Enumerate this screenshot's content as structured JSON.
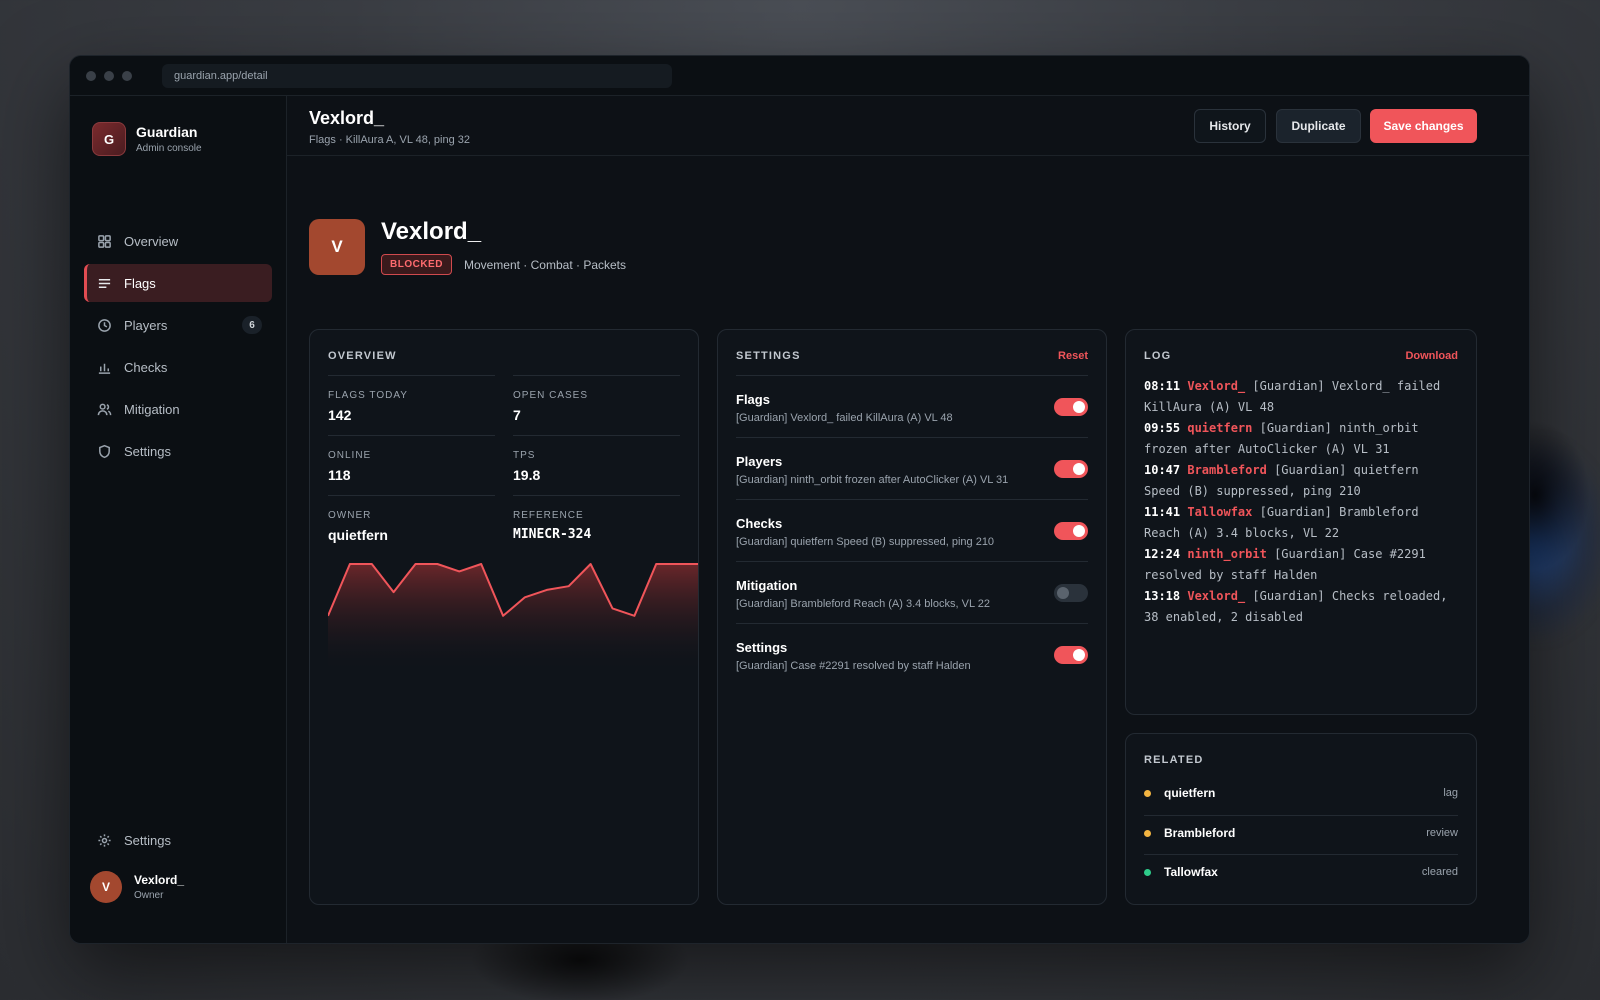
{
  "window": {
    "url": "guardian.app/detail"
  },
  "brand": {
    "logo_letter": "G",
    "name": "Guardian",
    "subtitle": "Admin console"
  },
  "nav": {
    "items": [
      {
        "label": "Overview",
        "icon": "grid-icon"
      },
      {
        "label": "Flags",
        "icon": "list-icon",
        "active": true
      },
      {
        "label": "Players",
        "icon": "clock-icon",
        "badge": "6"
      },
      {
        "label": "Checks",
        "icon": "bar-chart-icon"
      },
      {
        "label": "Mitigation",
        "icon": "users-icon"
      },
      {
        "label": "Settings",
        "icon": "shield-icon"
      }
    ],
    "bottom_settings": "Settings"
  },
  "user": {
    "initial": "V",
    "name": "Vexlord_",
    "role": "Owner"
  },
  "header": {
    "title": "Vexlord_",
    "subtitle": "Flags · KillAura A, VL 48, ping 32",
    "history_label": "History",
    "duplicate_label": "Duplicate",
    "save_label": "Save changes"
  },
  "hero": {
    "initial": "V",
    "name": "Vexlord_",
    "status": "BLOCKED",
    "tags": "Movement · Combat · Packets"
  },
  "overview": {
    "title": "OVERVIEW",
    "stats": [
      {
        "label": "FLAGS TODAY",
        "value": "142"
      },
      {
        "label": "OPEN CASES",
        "value": "7"
      },
      {
        "label": "ONLINE",
        "value": "118"
      },
      {
        "label": "TPS",
        "value": "19.8"
      },
      {
        "label": "OWNER",
        "value": "quietfern"
      },
      {
        "label": "REFERENCE",
        "value": "MINECR-324"
      }
    ],
    "sparkline": [
      30,
      100,
      100,
      62,
      100,
      100,
      90,
      100,
      30,
      55,
      65,
      70,
      100,
      40,
      30,
      100,
      100,
      100
    ]
  },
  "settings": {
    "title": "SETTINGS",
    "reset_label": "Reset",
    "items": [
      {
        "name": "Flags",
        "desc": "[Guardian] Vexlord_ failed KillAura (A) VL 48",
        "on": true
      },
      {
        "name": "Players",
        "desc": "[Guardian] ninth_orbit frozen after AutoClicker (A) VL 31",
        "on": true
      },
      {
        "name": "Checks",
        "desc": "[Guardian] quietfern Speed (B) suppressed, ping 210",
        "on": true
      },
      {
        "name": "Mitigation",
        "desc": "[Guardian] Brambleford Reach (A) 3.4 blocks, VL 22",
        "on": false
      },
      {
        "name": "Settings",
        "desc": "[Guardian] Case #2291 resolved by staff Halden",
        "on": true
      }
    ]
  },
  "log": {
    "title": "LOG",
    "download_label": "Download",
    "entries": [
      {
        "time": "08:11",
        "user": "Vexlord_",
        "text": "[Guardian] Vexlord_ failed KillAura (A) VL 48"
      },
      {
        "time": "09:55",
        "user": "quietfern",
        "text": "[Guardian] ninth_orbit frozen after AutoClicker (A) VL 31"
      },
      {
        "time": "10:47",
        "user": "Brambleford",
        "text": "[Guardian] quietfern Speed (B) suppressed, ping 210"
      },
      {
        "time": "11:41",
        "user": "Tallowfax",
        "text": "[Guardian] Brambleford Reach (A) 3.4 blocks, VL 22"
      },
      {
        "time": "12:24",
        "user": "ninth_orbit",
        "text": "[Guardian] Case #2291 resolved by staff Halden"
      },
      {
        "time": "13:18",
        "user": "Vexlord_",
        "text": "[Guardian] Checks reloaded, 38 enabled, 2 disabled"
      }
    ]
  },
  "related": {
    "title": "RELATED",
    "items": [
      {
        "name": "quietfern",
        "status": "lag",
        "color": "#f2b441"
      },
      {
        "name": "Brambleford",
        "status": "review",
        "color": "#f2b441"
      },
      {
        "name": "Tallowfax",
        "status": "cleared",
        "color": "#2ecc8a"
      }
    ]
  },
  "colors": {
    "accent": "#f0555a",
    "avatar": "#a3482f",
    "warning": "#f2b441",
    "success": "#2ecc8a"
  }
}
